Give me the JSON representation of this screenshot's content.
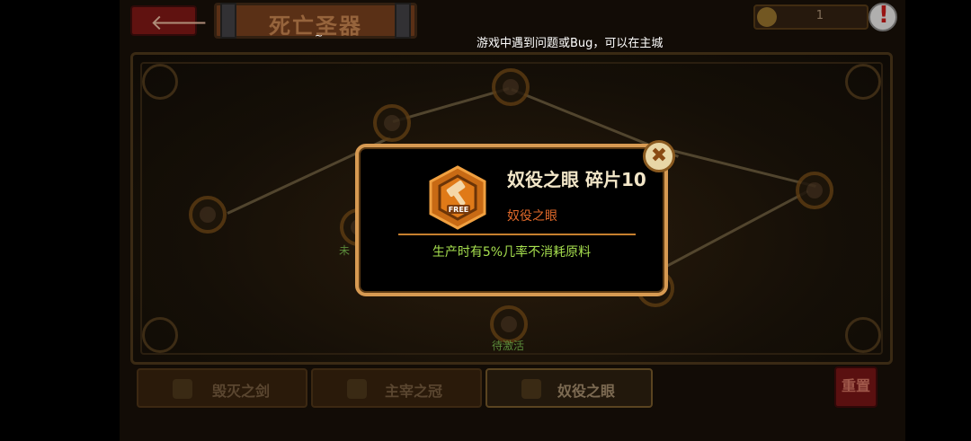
{
  "header": {
    "back_icon": "arrow-left-icon",
    "title": "死亡圣器",
    "notice": "游戏中遇到问题或Bug，可以在主城",
    "tilde": "~",
    "currency_value": "1",
    "alert_symbol": "!"
  },
  "tree": {
    "node_label_1": "未",
    "node_label_2": "待激活"
  },
  "tabs": [
    {
      "label": "毁灭之剑",
      "icon": "sword-icon"
    },
    {
      "label": "主宰之冠",
      "icon": "crown-icon"
    },
    {
      "label": "奴役之眼",
      "icon": "eye-icon"
    }
  ],
  "reset_label": "重置",
  "modal": {
    "item_name": "奴役之眼 碎片10",
    "item_sub": "奴役之眼",
    "badge_text": "FREE",
    "badge_icon": "hammer-icon",
    "description": "生产时有5%几率不消耗原料",
    "close_symbol": "✖"
  },
  "colors": {
    "modal_border": "#d79a52",
    "item_name": "#f2e6c8",
    "item_sub": "#e0692a",
    "description": "#a6df4e",
    "divider": "#c6802e"
  }
}
